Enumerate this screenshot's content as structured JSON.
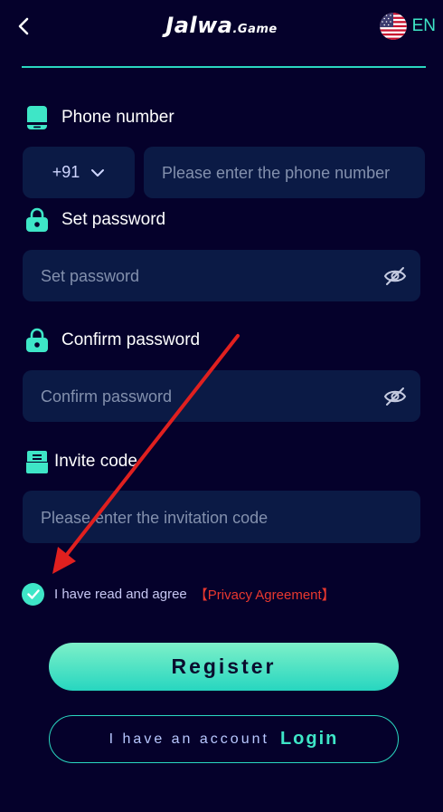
{
  "header": {
    "logo_main": "Jalwa",
    "logo_sub": ".Game",
    "language": "EN"
  },
  "phone": {
    "label": "Phone number",
    "country_code": "+91",
    "placeholder": "Please enter the phone number"
  },
  "password": {
    "label": "Set password",
    "placeholder": "Set password"
  },
  "confirm": {
    "label": "Confirm password",
    "placeholder": "Confirm password"
  },
  "invite": {
    "label": "Invite code",
    "placeholder": "Please enter the invitation code"
  },
  "agreement": {
    "text": "I have read and agree",
    "link": "【Privacy Agreement】",
    "checked": true
  },
  "actions": {
    "register": "Register",
    "have_account": "I have an account",
    "login": "Login"
  },
  "colors": {
    "background": "#05012b",
    "accent": "#3ee6c7",
    "field": "#0b1a45",
    "link": "#e8382f",
    "annotation_arrow": "#e0201f"
  }
}
